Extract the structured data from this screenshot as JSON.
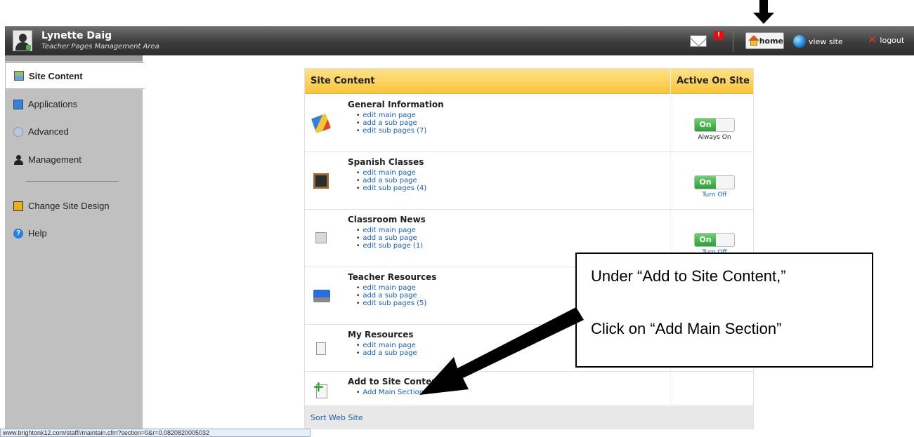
{
  "header": {
    "user_name": "Lynette Daig",
    "subtitle": "Teacher Pages Management Area",
    "mail_badge": "!",
    "home_label": "home",
    "view_site_label": "view site",
    "logout_label": "logout"
  },
  "sidebar": {
    "items": [
      {
        "label": "Site Content",
        "icon": "site-content-icon"
      },
      {
        "label": "Applications",
        "icon": "applications-icon"
      },
      {
        "label": "Advanced",
        "icon": "advanced-icon"
      },
      {
        "label": "Management",
        "icon": "user-icon"
      },
      {
        "label": "Change Site Design",
        "icon": "design-icon"
      },
      {
        "label": "Help",
        "icon": "help-icon"
      }
    ]
  },
  "table": {
    "header_title": "Site Content",
    "header_active": "Active On Site",
    "rows": [
      {
        "title": "General Information",
        "links": [
          "edit main page",
          "add a sub page",
          "edit sub pages (7)"
        ],
        "toggle": "On",
        "toggle_label": "Always On"
      },
      {
        "title": "Spanish Classes",
        "links": [
          "edit main page",
          "add a sub page",
          "edit sub pages (4)"
        ],
        "toggle": "On",
        "toggle_label": "Turn Off"
      },
      {
        "title": "Classroom News",
        "links": [
          "edit main page",
          "add a sub page",
          "edit sub page (1)"
        ],
        "toggle": "On",
        "toggle_label": "Turn Off"
      },
      {
        "title": "Teacher Resources",
        "links": [
          "edit main page",
          "add a sub page",
          "edit sub pages (5)"
        ]
      },
      {
        "title": "My Resources",
        "links": [
          "edit main page",
          "add a sub page"
        ]
      },
      {
        "title": "Add to Site Content",
        "links": [
          "Add Main Section"
        ]
      }
    ],
    "sort_link": "Sort Web Site"
  },
  "callout": {
    "line1": "Under “Add to Site Content,”",
    "line2": "Click on “Add Main Section”"
  },
  "status_bar": "www.brightonk12.com/staff//maintain.cfm?section=0&r=0.0820820005032",
  "colors": {
    "accent_header": "#f7c43a",
    "toggle_on": "#2f9e3a",
    "link": "#1b5fa8"
  }
}
